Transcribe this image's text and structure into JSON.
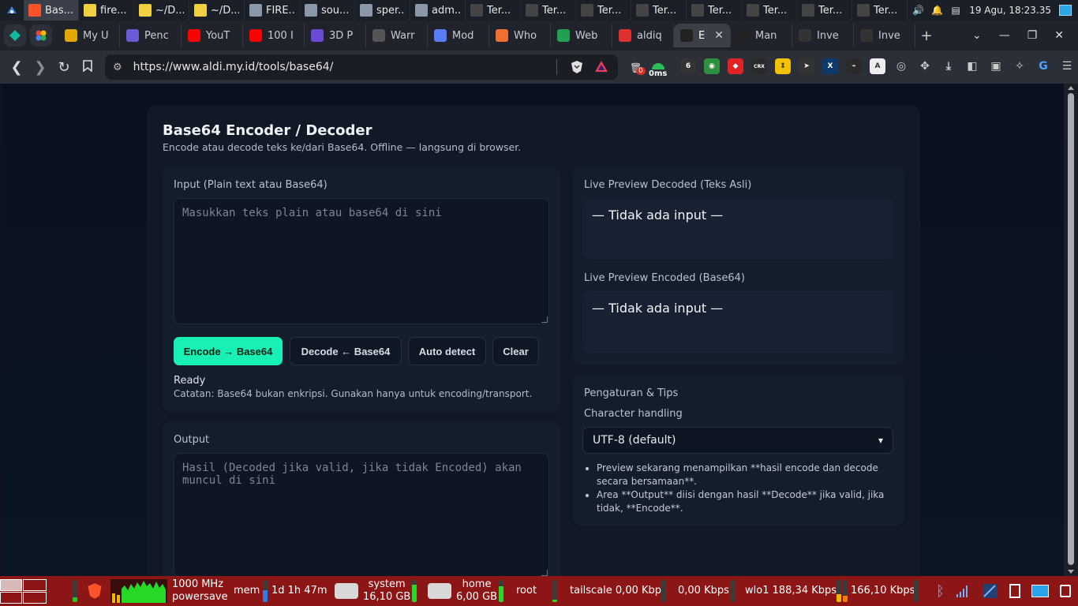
{
  "os_top": {
    "tasks": [
      {
        "label": "Bas...",
        "icon": "brave-icon",
        "color": "#fb542b",
        "active": true
      },
      {
        "label": "fire...",
        "icon": "notepad-icon",
        "color": "#f0d040"
      },
      {
        "label": "~/D...",
        "icon": "notepad-icon",
        "color": "#f0d040"
      },
      {
        "label": "~/D...",
        "icon": "notepad-icon",
        "color": "#f0d040"
      },
      {
        "label": "FIRE...",
        "icon": "folder-icon",
        "color": "#8a97a8"
      },
      {
        "label": "sou...",
        "icon": "folder-icon",
        "color": "#8a97a8"
      },
      {
        "label": "sper...",
        "icon": "folder-icon",
        "color": "#8a97a8"
      },
      {
        "label": "adm...",
        "icon": "folder-icon",
        "color": "#8a97a8"
      },
      {
        "label": "Ter...",
        "icon": "terminal-icon",
        "color": "#444"
      },
      {
        "label": "Ter...",
        "icon": "terminal-icon",
        "color": "#444"
      },
      {
        "label": "Ter...",
        "icon": "terminal-icon",
        "color": "#444"
      },
      {
        "label": "Ter...",
        "icon": "terminal-icon",
        "color": "#444"
      },
      {
        "label": "Ter...",
        "icon": "terminal-icon",
        "color": "#444"
      },
      {
        "label": "Ter...",
        "icon": "terminal-icon",
        "color": "#444"
      },
      {
        "label": "Ter...",
        "icon": "terminal-icon",
        "color": "#444"
      },
      {
        "label": "Ter...",
        "icon": "terminal-icon",
        "color": "#444"
      }
    ],
    "clock": "19 Agu, 18:23.35"
  },
  "tabs": [
    {
      "label": "My U",
      "icon": "ubuntu-icon",
      "color": "#e0a800"
    },
    {
      "label": "Penc",
      "icon": "pencil-icon",
      "color": "#6b5bd6"
    },
    {
      "label": "YouT",
      "icon": "youtube-icon",
      "color": "#ff0000"
    },
    {
      "label": "100 I",
      "icon": "youtube-icon",
      "color": "#ff0000"
    },
    {
      "label": "3D P",
      "icon": "pt-icon",
      "color": "#6a4ad6"
    },
    {
      "label": "Warr",
      "icon": "openai-icon",
      "color": "#555"
    },
    {
      "label": "Mod",
      "icon": "gemini-icon",
      "color": "#5b7cfa"
    },
    {
      "label": "Who",
      "icon": "flame-icon",
      "color": "#f07030"
    },
    {
      "label": "Web",
      "icon": "database-icon",
      "color": "#20a050"
    },
    {
      "label": "aldiq",
      "icon": "fire-icon",
      "color": "#e03030"
    },
    {
      "label": "E",
      "icon": "angular-icon",
      "color": "#222",
      "active": true
    },
    {
      "label": "Man",
      "icon": "angular-icon",
      "color": "#222"
    },
    {
      "label": "Inve",
      "icon": "arrow-up-icon",
      "color": "#333"
    },
    {
      "label": "Inve",
      "icon": "arrow-up-icon",
      "color": "#333"
    }
  ],
  "toolbar": {
    "url": "https://www.aldi.my.id/tools/base64/",
    "ext_badge_count": "0",
    "ext_ping": "0ms"
  },
  "page": {
    "title": "Base64 Encoder / Decoder",
    "subtitle": "Encode atau decode teks ke/dari Base64. Offline — langsung di browser.",
    "input_label": "Input (Plain text atau Base64)",
    "input_placeholder": "Masukkan teks plain atau base64 di sini",
    "buttons": {
      "encode": "Encode → Base64",
      "decode": "Decode ← Base64",
      "auto": "Auto detect",
      "clear": "Clear"
    },
    "status": "Ready",
    "note": "Catatan: Base64 bukan enkripsi. Gunakan hanya untuk encoding/transport.",
    "output_label": "Output",
    "output_placeholder": "Hasil (Decoded jika valid, jika tidak Encoded) akan muncul di sini",
    "preview_decoded_label": "Live Preview Decoded (Teks Asli)",
    "preview_decoded_value": "— Tidak ada input —",
    "preview_encoded_label": "Live Preview Encoded (Base64)",
    "preview_encoded_value": "— Tidak ada input —",
    "settings_title": "Pengaturan & Tips",
    "charset_label": "Character handling",
    "charset_value": "UTF-8 (default)",
    "tips": [
      "Preview sekarang menampilkan **hasil encode dan decode secara bersamaan**.",
      "Area **Output** diisi dengan hasil **Decode** jika valid, jika tidak, **Encode**."
    ],
    "accent": "#19f0b4"
  },
  "os_bottom": {
    "cpu_freq": "1000 MHz",
    "cpu_governor": "powersave",
    "mem_label": "mem",
    "uptime": "1d 1h 47m",
    "disk_system_label": "system",
    "disk_system_size": "16,10 GB",
    "disk_home_label": "home",
    "disk_home_size": "6,00 GB",
    "disk_root_label": "root",
    "net_tailscale": "tailscale 0,00 Kbps",
    "net_tailscale_up": "0,00 Kbps",
    "net_wlo1": "wlo1 188,34 Kbps",
    "net_wlo1_up": "166,10 Kbps",
    "panel_color": "#8c1515"
  }
}
